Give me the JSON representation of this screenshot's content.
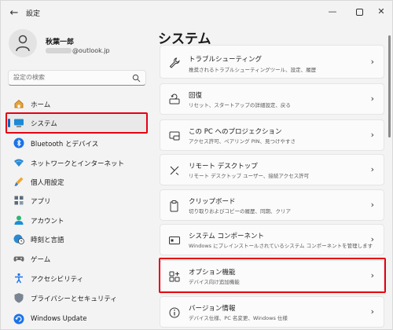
{
  "window": {
    "title": "設定",
    "back_icon": "back-arrow-icon",
    "controls": {
      "minimize": "—",
      "close": "✕"
    }
  },
  "profile": {
    "name": "秋葉一郎",
    "email_suffix": "@outlook.jp"
  },
  "search": {
    "placeholder": "設定の検索"
  },
  "nav": {
    "selected_index": 1,
    "items": [
      {
        "label": "ホーム",
        "icon": "home-icon"
      },
      {
        "label": "システム",
        "icon": "monitor-icon"
      },
      {
        "label": "Bluetooth とデバイス",
        "icon": "bluetooth-icon"
      },
      {
        "label": "ネットワークとインターネット",
        "icon": "wifi-icon"
      },
      {
        "label": "個人用設定",
        "icon": "brush-icon"
      },
      {
        "label": "アプリ",
        "icon": "apps-icon"
      },
      {
        "label": "アカウント",
        "icon": "account-icon"
      },
      {
        "label": "時刻と言語",
        "icon": "globe-clock-icon"
      },
      {
        "label": "ゲーム",
        "icon": "gamepad-icon"
      },
      {
        "label": "アクセシビリティ",
        "icon": "accessibility-icon"
      },
      {
        "label": "プライバシーとセキュリティ",
        "icon": "shield-icon"
      },
      {
        "label": "Windows Update",
        "icon": "update-icon"
      }
    ]
  },
  "main": {
    "title": "システム",
    "cards": [
      {
        "title": "トラブルシューティング",
        "desc": "推奨されるトラブルシューティングツール、設定、履歴",
        "icon": "wrench-icon"
      },
      {
        "title": "回復",
        "desc": "リセット、スタートアップの詳細設定、戻る",
        "icon": "recovery-icon"
      },
      {
        "title": "この PC へのプロジェクション",
        "desc": "アクセス許可、ペアリング PIN、見つけやすさ",
        "icon": "projection-icon"
      },
      {
        "title": "リモート デスクトップ",
        "desc": "リモート デスクトップ ユーザー、接続アクセス許可",
        "icon": "remote-desktop-icon"
      },
      {
        "title": "クリップボード",
        "desc": "切り取りおよびコピーの履歴、同期、クリア",
        "icon": "clipboard-icon"
      },
      {
        "title": "システム コンポーネント",
        "desc": "Windows にプレインストールされているシステム コンポーネントを管理します",
        "icon": "system-components-icon"
      },
      {
        "title": "オプション機能",
        "desc": "デバイス向け追加機能",
        "icon": "optional-features-icon"
      },
      {
        "title": "バージョン情報",
        "desc": "デバイス仕様、PC 名変更、Windows 仕様",
        "icon": "info-icon"
      }
    ]
  },
  "colors": {
    "accent": "#0067c0",
    "highlight": "#e60012",
    "background": "#f3f3f3",
    "card": "#fbfbfb"
  }
}
